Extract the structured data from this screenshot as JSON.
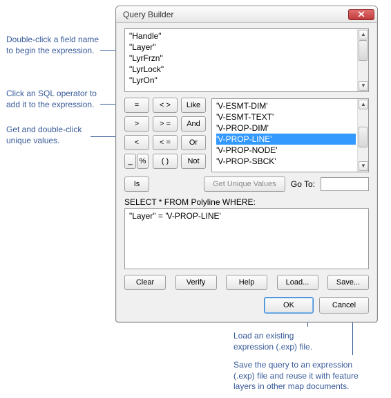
{
  "window": {
    "title": "Query Builder"
  },
  "fields": {
    "items": [
      "\"Handle\"",
      "\"Layer\"",
      "\"LyrFrzn\"",
      "\"LyrLock\"",
      "\"LyrOn\""
    ]
  },
  "operators": {
    "eq": "=",
    "neq": "< >",
    "like": "Like",
    "gt": ">",
    "gte": "> =",
    "and": "And",
    "lt": "<",
    "lte": "< =",
    "or": "Or",
    "us": "_",
    "pct": "%",
    "paren": "( )",
    "not": "Not",
    "is": "Is"
  },
  "values": {
    "items": [
      "'V-ESMT-DIM'",
      "'V-ESMT-TEXT'",
      "'V-PROP-DIM'",
      "'V-PROP-LINE'",
      "'V-PROP-NODE'",
      "'V-PROP-SBCK'"
    ],
    "selected_index": 3
  },
  "unique": {
    "button": "Get Unique Values",
    "goto_label": "Go To:",
    "goto_value": ""
  },
  "select": {
    "label": "SELECT * FROM Polyline WHERE:",
    "expression": "\"Layer\" = 'V-PROP-LINE'"
  },
  "buttons": {
    "clear": "Clear",
    "verify": "Verify",
    "help": "Help",
    "load": "Load...",
    "save": "Save...",
    "ok": "OK",
    "cancel": "Cancel"
  },
  "annotations": {
    "a1": "Double-click a field name\nto begin the expression.",
    "a2": "Click an SQL operator to\nadd it to the expression.",
    "a3": "Get and double-click\nunique values.",
    "a4": "Load an existing\nexpression (.exp) file.",
    "a5": "Save the query to an expression\n(.exp) file and reuse it with feature\nlayers in other map documents."
  }
}
